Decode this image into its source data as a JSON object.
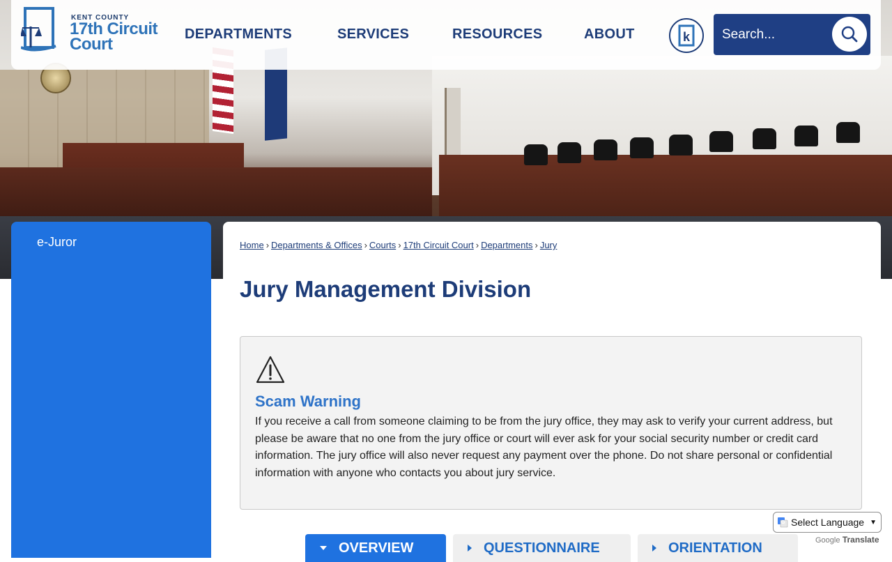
{
  "header": {
    "logo": {
      "line_small": "KENT COUNTY",
      "line1": "17th Circuit",
      "line2": "Court"
    },
    "nav": [
      {
        "label": "DEPARTMENTS"
      },
      {
        "label": "SERVICES"
      },
      {
        "label": "RESOURCES"
      },
      {
        "label": "ABOUT"
      }
    ],
    "badge_letter": "k",
    "search": {
      "placeholder": "Search..."
    }
  },
  "sidebar": {
    "items": [
      {
        "label": "e-Juror"
      }
    ]
  },
  "breadcrumb": {
    "links": [
      "Home",
      "Departments & Offices",
      "Courts",
      "17th Circuit Court",
      "Departments",
      "Jury"
    ],
    "separator": "›"
  },
  "page": {
    "title": "Jury Management Division"
  },
  "alert": {
    "title": "Scam Warning",
    "body": "If you receive a call from someone claiming to be from the jury office, they may ask to verify your current address, but please be aware that no one from the jury office or court will ever ask for your social security number or credit card information. The jury office will also never request any payment over the phone. Do not share personal or confidential information with anyone who contacts you about jury service."
  },
  "tabs": [
    {
      "label": "OVERVIEW",
      "active": true
    },
    {
      "label": "QUESTIONNAIRE",
      "active": false
    },
    {
      "label": "ORIENTATION",
      "active": false
    }
  ],
  "translate": {
    "select_label": "Select Language",
    "powered_brand": "Google",
    "powered_word": "Translate"
  },
  "colors": {
    "navy": "#1d3c78",
    "accent_blue": "#1f72e0",
    "link_blue": "#2e73c8"
  }
}
